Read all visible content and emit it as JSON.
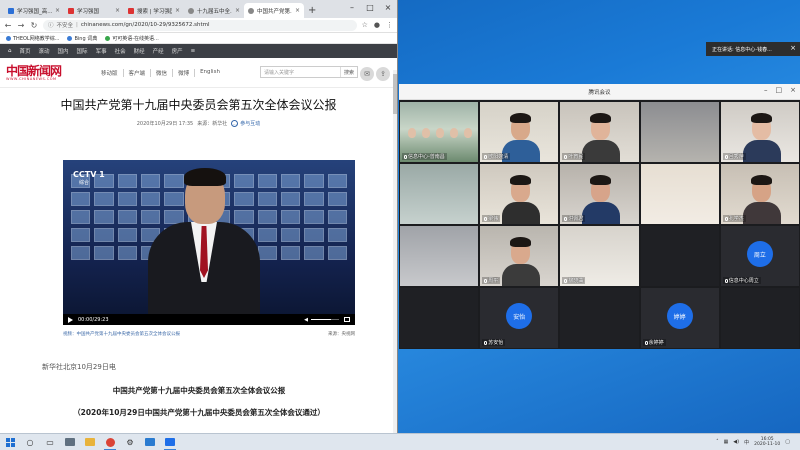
{
  "desktop": {
    "toast_text": "正在讲话: 信息中心-钱春..."
  },
  "browser": {
    "tabs": [
      {
        "label": "学习强国_高...",
        "favicon": "red"
      },
      {
        "label": "学习强国",
        "favicon": "red"
      },
      {
        "label": "搜索 | 学习强国",
        "favicon": "red"
      },
      {
        "label": "十九届五中全...",
        "favicon": "gray"
      },
      {
        "label": "中国共产党第...",
        "favicon": "gray",
        "active": true
      }
    ],
    "address": {
      "security": "不安全",
      "url": "chinanews.com/gn/2020/10-29/9325672.shtml"
    },
    "bookmarks": [
      {
        "label": "THEOL网络教学综..."
      },
      {
        "label": "Bing 词典"
      },
      {
        "label": "可可英语-在线英语..."
      }
    ],
    "site_nav": [
      "首页",
      "滚动",
      "国内",
      "国际",
      "军事",
      "社会",
      "财经",
      "产经",
      "房产",
      "≡"
    ],
    "logo_text": "中国新闻网",
    "logo_sub": "WWW.CHINANEWS.COM",
    "head_links": [
      "移动版",
      "客户端",
      "微信",
      "微博",
      "English"
    ],
    "search": {
      "placeholder": "请输入关键字",
      "button": "搜索"
    },
    "article": {
      "title": "中国共产党第十九届中央委员会第五次全体会议公报",
      "date": "2020年10月29日 17:35",
      "source": "来源：新华社",
      "interact": "参与互动",
      "video": {
        "channel": "CCTV 1",
        "channel_sub": "综合",
        "time": "00:00/29:23",
        "volume": 0.7
      },
      "caption": "视频：中国共产党第十九届中央委员会第五次全体会议公报",
      "caption_source": "来源：央视网",
      "dateline": "新华社北京10月29日电",
      "heading": "中国共产党第十九届中央委员会第五次全体会议公报",
      "subheading": "（2020年10月29日中国共产党第十九届中央委员会第五次全体会议通过）"
    }
  },
  "meeting": {
    "title": "腾讯会议",
    "participants": [
      {
        "name": "信息中心-曾南昌",
        "type": "video"
      },
      {
        "name": "欧阳婉清",
        "type": "video"
      },
      {
        "name": "叶育民",
        "type": "video"
      },
      {
        "name": "",
        "type": "video"
      },
      {
        "name": "吕秀萍",
        "type": "video"
      },
      {
        "name": "",
        "type": "video"
      },
      {
        "name": "梁伟",
        "type": "video"
      },
      {
        "name": "洪佩君",
        "type": "video"
      },
      {
        "name": "",
        "type": "video"
      },
      {
        "name": "孔学杰",
        "type": "video"
      },
      {
        "name": "",
        "type": "video"
      },
      {
        "name": "周平",
        "type": "video"
      },
      {
        "name": "柳晓曲",
        "type": "video"
      },
      {
        "name": "",
        "type": "dark"
      },
      {
        "name": "信息中心周立",
        "type": "avatar",
        "avatar": "周立"
      },
      {
        "name": "",
        "type": "dark"
      },
      {
        "name": "苏安怡",
        "type": "avatar",
        "avatar": "安怡"
      },
      {
        "name": "",
        "type": "dark"
      },
      {
        "name": "余婷婷",
        "type": "avatar",
        "avatar": "婷婷"
      },
      {
        "name": "",
        "type": "dark"
      }
    ]
  },
  "taskbar": {
    "time": "16:05",
    "date": "2020-11-10"
  }
}
